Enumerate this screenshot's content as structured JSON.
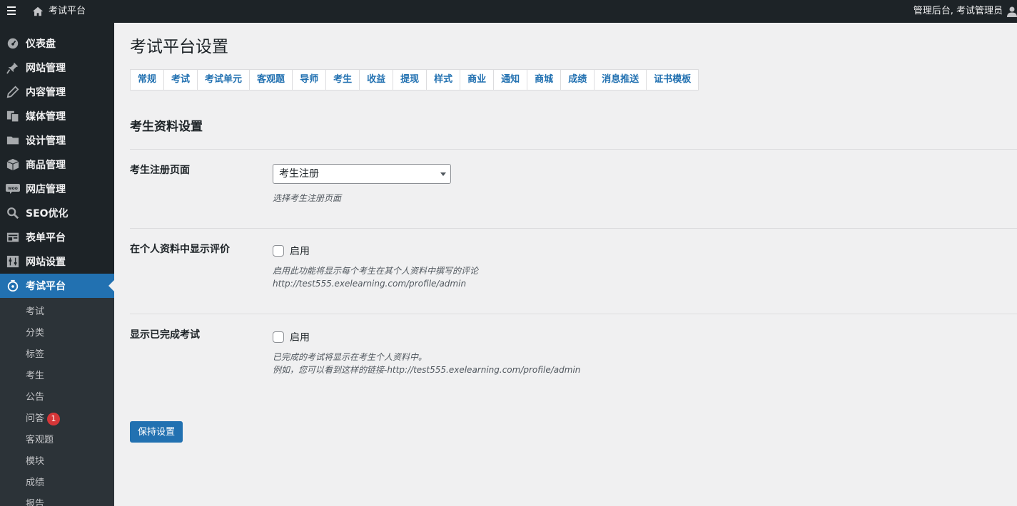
{
  "adminbar": {
    "site_name": "考试平台",
    "account": "管理后台, 考试管理员"
  },
  "sidebar": {
    "items": [
      {
        "label": "仪表盘",
        "icon": "dashboard-icon"
      },
      {
        "label": "网站管理",
        "icon": "pin-icon"
      },
      {
        "label": "内容管理",
        "icon": "pencil-icon"
      },
      {
        "label": "媒体管理",
        "icon": "media-icon"
      },
      {
        "label": "设计管理",
        "icon": "folder-icon"
      },
      {
        "label": "商品管理",
        "icon": "box-icon"
      },
      {
        "label": "网店管理",
        "icon": "woo-icon"
      },
      {
        "label": "SEO优化",
        "icon": "search-icon"
      },
      {
        "label": "表单平台",
        "icon": "form-icon"
      },
      {
        "label": "网站设置",
        "icon": "settings-icon"
      },
      {
        "label": "考试平台",
        "icon": "exam-icon"
      }
    ],
    "submenu": [
      {
        "label": "考试"
      },
      {
        "label": "分类"
      },
      {
        "label": "标签"
      },
      {
        "label": "考生"
      },
      {
        "label": "公告"
      },
      {
        "label": "问答",
        "badge": "1"
      },
      {
        "label": "客观题"
      },
      {
        "label": "模块"
      },
      {
        "label": "成绩"
      },
      {
        "label": "报告"
      }
    ]
  },
  "main": {
    "page_title": "考试平台设置",
    "tabs": [
      "常规",
      "考试",
      "考试单元",
      "客观题",
      "导师",
      "考生",
      "收益",
      "提现",
      "样式",
      "商业",
      "通知",
      "商城",
      "成绩",
      "消息推送",
      "证书模板"
    ],
    "section_title": "考生资料设置",
    "registration": {
      "label": "考生注册页面",
      "selected": "考生注册",
      "description": "选择考生注册页面"
    },
    "show_reviews": {
      "label": "在个人资料中显示评价",
      "checkbox_label": "启用",
      "description_line1": "启用此功能将显示每个考生在其个人资料中撰写的评论",
      "description_line2": "http://test555.exelearning.com/profile/admin"
    },
    "show_completed": {
      "label": "显示已完成考试",
      "checkbox_label": "启用",
      "description_line1": "已完成的考试将显示在考生个人资料中。",
      "description_line2": "例如，您可以看到这样的链接-http://test555.exelearning.com/profile/admin"
    },
    "save_label": "保持设置"
  },
  "colors": {
    "accent": "#2271b1",
    "sidebar_bg": "#1d2327",
    "page_bg": "#f0f0f1",
    "badge": "#d63638"
  }
}
